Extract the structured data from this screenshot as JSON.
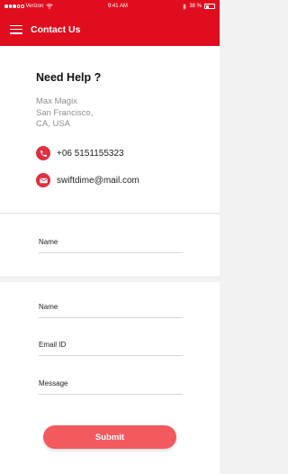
{
  "status_bar": {
    "carrier": "Verizon",
    "time": "9:41 AM",
    "battery": "38 %"
  },
  "header": {
    "title": "Contact Us"
  },
  "help": {
    "title": "Need Help ?",
    "address_lines": [
      "Max Magix",
      "San Francisco,",
      "CA, USA"
    ],
    "phone": "+06 5151155323",
    "email": "swiftdime@mail.com"
  },
  "single_form": {
    "name_label": "Name"
  },
  "contact_form": {
    "name_label": "Name",
    "email_label": "Email ID",
    "message_label": "Message",
    "submit_label": "Submit"
  },
  "colors": {
    "brand": "#e00d1e",
    "button": "#f25a5e",
    "icon_bg": "#e0303f"
  },
  "icons": {
    "menu": "hamburger-icon",
    "phone": "phone-icon",
    "email": "envelope-icon"
  }
}
